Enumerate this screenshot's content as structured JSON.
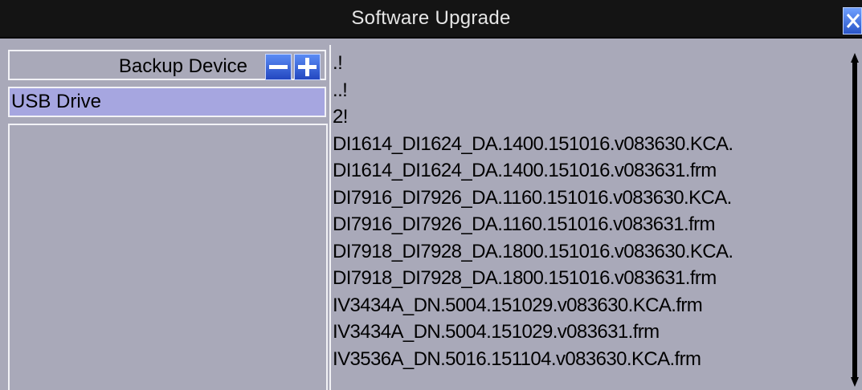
{
  "window": {
    "title": "Software Upgrade"
  },
  "left": {
    "device_label": "Backup Device",
    "minus_glyph": "−",
    "plus_glyph": "+",
    "selected_device": "USB Drive"
  },
  "files": [
    ".!",
    "..!",
    "2!",
    "DI1614_DI1624_DA.1400.151016.v083630.KCA.",
    "DI1614_DI1624_DA.1400.151016.v083631.frm",
    "DI7916_DI7926_DA.1160.151016.v083630.KCA.",
    "DI7916_DI7926_DA.1160.151016.v083631.frm",
    "DI7918_DI7928_DA.1800.151016.v083630.KCA.",
    "DI7918_DI7928_DA.1800.151016.v083631.frm",
    "IV3434A_DN.5004.151029.v083630.KCA.frm",
    "IV3434A_DN.5004.151029.v083631.frm",
    "IV3536A_DN.5016.151104.v083630.KCA.frm"
  ],
  "colors": {
    "background": "#a9a9b9",
    "titlebar": "#141414",
    "selection": "#a6a6e0",
    "accent_button": "#2a55c8"
  },
  "icons": {
    "close": "close-icon",
    "minus": "minus-icon",
    "plus": "plus-icon",
    "scroll_up": "triangle-up-icon",
    "scroll_down": "triangle-down-icon"
  }
}
